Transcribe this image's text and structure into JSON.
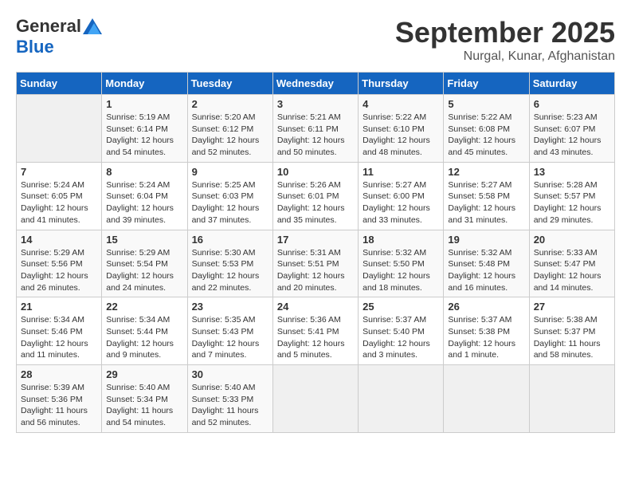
{
  "logo": {
    "general": "General",
    "blue": "Blue"
  },
  "header": {
    "month": "September 2025",
    "location": "Nurgal, Kunar, Afghanistan"
  },
  "weekdays": [
    "Sunday",
    "Monday",
    "Tuesday",
    "Wednesday",
    "Thursday",
    "Friday",
    "Saturday"
  ],
  "weeks": [
    [
      {
        "day": null,
        "info": null
      },
      {
        "day": "1",
        "info": "Sunrise: 5:19 AM\nSunset: 6:14 PM\nDaylight: 12 hours\nand 54 minutes."
      },
      {
        "day": "2",
        "info": "Sunrise: 5:20 AM\nSunset: 6:12 PM\nDaylight: 12 hours\nand 52 minutes."
      },
      {
        "day": "3",
        "info": "Sunrise: 5:21 AM\nSunset: 6:11 PM\nDaylight: 12 hours\nand 50 minutes."
      },
      {
        "day": "4",
        "info": "Sunrise: 5:22 AM\nSunset: 6:10 PM\nDaylight: 12 hours\nand 48 minutes."
      },
      {
        "day": "5",
        "info": "Sunrise: 5:22 AM\nSunset: 6:08 PM\nDaylight: 12 hours\nand 45 minutes."
      },
      {
        "day": "6",
        "info": "Sunrise: 5:23 AM\nSunset: 6:07 PM\nDaylight: 12 hours\nand 43 minutes."
      }
    ],
    [
      {
        "day": "7",
        "info": "Sunrise: 5:24 AM\nSunset: 6:05 PM\nDaylight: 12 hours\nand 41 minutes."
      },
      {
        "day": "8",
        "info": "Sunrise: 5:24 AM\nSunset: 6:04 PM\nDaylight: 12 hours\nand 39 minutes."
      },
      {
        "day": "9",
        "info": "Sunrise: 5:25 AM\nSunset: 6:03 PM\nDaylight: 12 hours\nand 37 minutes."
      },
      {
        "day": "10",
        "info": "Sunrise: 5:26 AM\nSunset: 6:01 PM\nDaylight: 12 hours\nand 35 minutes."
      },
      {
        "day": "11",
        "info": "Sunrise: 5:27 AM\nSunset: 6:00 PM\nDaylight: 12 hours\nand 33 minutes."
      },
      {
        "day": "12",
        "info": "Sunrise: 5:27 AM\nSunset: 5:58 PM\nDaylight: 12 hours\nand 31 minutes."
      },
      {
        "day": "13",
        "info": "Sunrise: 5:28 AM\nSunset: 5:57 PM\nDaylight: 12 hours\nand 29 minutes."
      }
    ],
    [
      {
        "day": "14",
        "info": "Sunrise: 5:29 AM\nSunset: 5:56 PM\nDaylight: 12 hours\nand 26 minutes."
      },
      {
        "day": "15",
        "info": "Sunrise: 5:29 AM\nSunset: 5:54 PM\nDaylight: 12 hours\nand 24 minutes."
      },
      {
        "day": "16",
        "info": "Sunrise: 5:30 AM\nSunset: 5:53 PM\nDaylight: 12 hours\nand 22 minutes."
      },
      {
        "day": "17",
        "info": "Sunrise: 5:31 AM\nSunset: 5:51 PM\nDaylight: 12 hours\nand 20 minutes."
      },
      {
        "day": "18",
        "info": "Sunrise: 5:32 AM\nSunset: 5:50 PM\nDaylight: 12 hours\nand 18 minutes."
      },
      {
        "day": "19",
        "info": "Sunrise: 5:32 AM\nSunset: 5:48 PM\nDaylight: 12 hours\nand 16 minutes."
      },
      {
        "day": "20",
        "info": "Sunrise: 5:33 AM\nSunset: 5:47 PM\nDaylight: 12 hours\nand 14 minutes."
      }
    ],
    [
      {
        "day": "21",
        "info": "Sunrise: 5:34 AM\nSunset: 5:46 PM\nDaylight: 12 hours\nand 11 minutes."
      },
      {
        "day": "22",
        "info": "Sunrise: 5:34 AM\nSunset: 5:44 PM\nDaylight: 12 hours\nand 9 minutes."
      },
      {
        "day": "23",
        "info": "Sunrise: 5:35 AM\nSunset: 5:43 PM\nDaylight: 12 hours\nand 7 minutes."
      },
      {
        "day": "24",
        "info": "Sunrise: 5:36 AM\nSunset: 5:41 PM\nDaylight: 12 hours\nand 5 minutes."
      },
      {
        "day": "25",
        "info": "Sunrise: 5:37 AM\nSunset: 5:40 PM\nDaylight: 12 hours\nand 3 minutes."
      },
      {
        "day": "26",
        "info": "Sunrise: 5:37 AM\nSunset: 5:38 PM\nDaylight: 12 hours\nand 1 minute."
      },
      {
        "day": "27",
        "info": "Sunrise: 5:38 AM\nSunset: 5:37 PM\nDaylight: 11 hours\nand 58 minutes."
      }
    ],
    [
      {
        "day": "28",
        "info": "Sunrise: 5:39 AM\nSunset: 5:36 PM\nDaylight: 11 hours\nand 56 minutes."
      },
      {
        "day": "29",
        "info": "Sunrise: 5:40 AM\nSunset: 5:34 PM\nDaylight: 11 hours\nand 54 minutes."
      },
      {
        "day": "30",
        "info": "Sunrise: 5:40 AM\nSunset: 5:33 PM\nDaylight: 11 hours\nand 52 minutes."
      },
      {
        "day": null,
        "info": null
      },
      {
        "day": null,
        "info": null
      },
      {
        "day": null,
        "info": null
      },
      {
        "day": null,
        "info": null
      }
    ]
  ]
}
